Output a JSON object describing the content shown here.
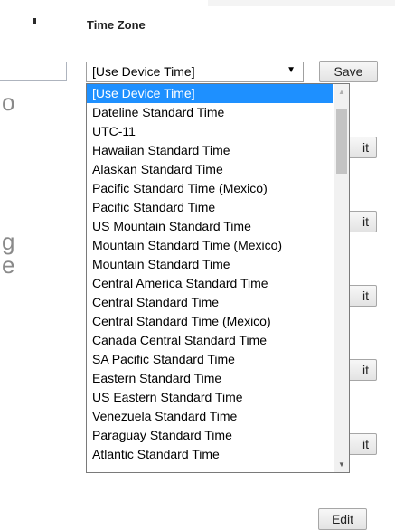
{
  "header": {
    "title": "Time Zone"
  },
  "background_text": [
    "o",
    "g",
    "e"
  ],
  "timezone_select": {
    "value": "[Use Device Time]",
    "arrow": "▼",
    "options": [
      "[Use Device Time]",
      "Dateline Standard Time",
      "UTC-11",
      "Hawaiian Standard Time",
      "Alaskan Standard Time",
      "Pacific Standard Time (Mexico)",
      "Pacific Standard Time",
      "US Mountain Standard Time",
      "Mountain Standard Time (Mexico)",
      "Mountain Standard Time",
      "Central America Standard Time",
      "Central Standard Time",
      "Central Standard Time (Mexico)",
      "Canada Central Standard Time",
      "SA Pacific Standard Time",
      "Eastern Standard Time",
      "US Eastern Standard Time",
      "Venezuela Standard Time",
      "Paraguay Standard Time",
      "Atlantic Standard Time"
    ],
    "selected_index": 0
  },
  "buttons": {
    "save": "Save",
    "edit": "Edit",
    "edit_partial": "it"
  },
  "scroll_icons": {
    "up": "▲",
    "down": "▼"
  },
  "colors": {
    "selected": "#1e90ff",
    "border": "#7a7a7a"
  }
}
